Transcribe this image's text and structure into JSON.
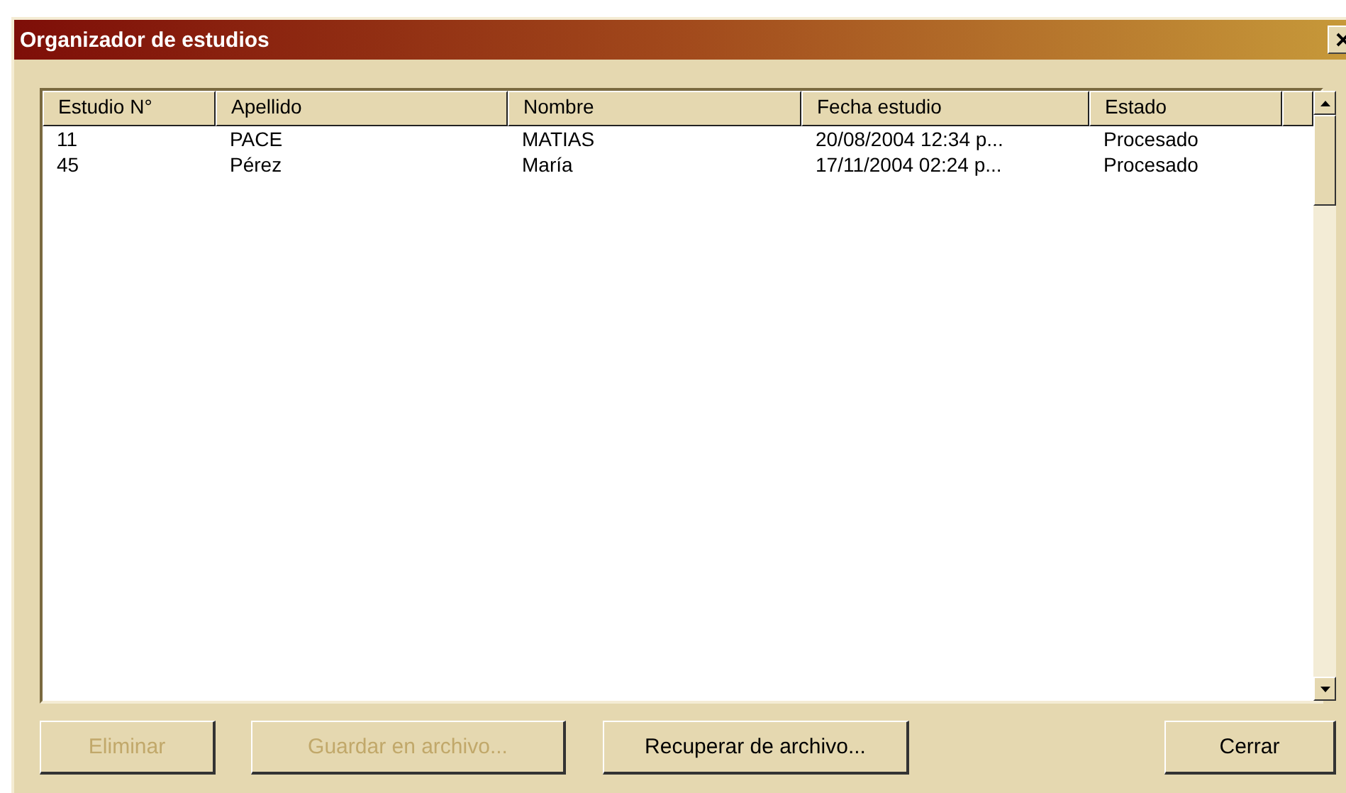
{
  "window": {
    "title": "Organizador de estudios"
  },
  "table": {
    "columns": [
      "Estudio N°",
      "Apellido",
      "Nombre",
      "Fecha estudio",
      "Estado"
    ],
    "rows": [
      [
        "11",
        "PACE",
        "MATIAS",
        "20/08/2004 12:34 p...",
        "Procesado"
      ],
      [
        "45",
        "Pérez",
        "María",
        "17/11/2004 02:24 p...",
        "Procesado"
      ]
    ]
  },
  "buttons": [
    {
      "label": "Eliminar",
      "disabled": true
    },
    {
      "label": "Guardar en archivo...",
      "disabled": true
    },
    {
      "label": "Recuperar de archivo...",
      "disabled": false
    },
    {
      "label": "Cerrar",
      "disabled": false
    }
  ]
}
